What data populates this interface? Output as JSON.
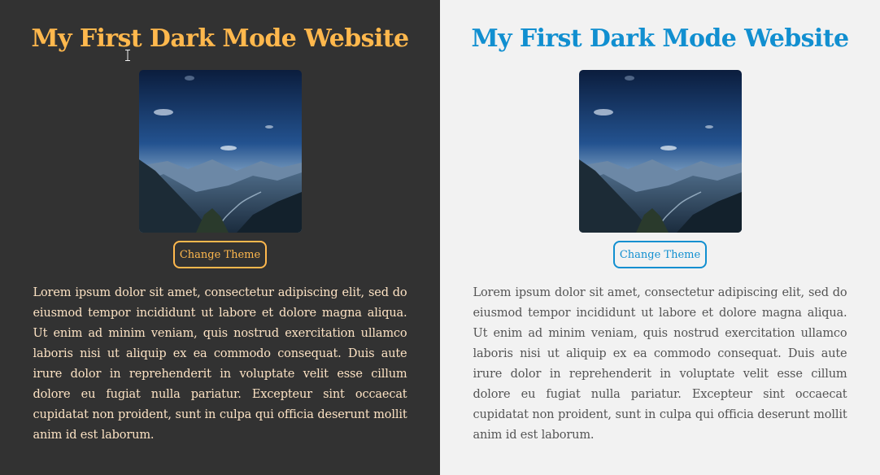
{
  "dark_panel": {
    "title": "My First Dark Mode Website",
    "button_label": "Change Theme",
    "body": "Lorem ipsum dolor sit amet, consectetur adipiscing elit, sed do eiusmod tempor incididunt ut labore et dolore magna aliqua. Ut enim ad minim veniam, quis nostrud exercitation ullamco laboris nisi ut aliquip ex ea commodo consequat. Duis aute irure dolor in reprehenderit in voluptate velit esse cillum dolore eu fugiat nulla pariatur. Excepteur sint occaecat cupidatat non proident, sunt in culpa qui officia deserunt mollit anim id est laborum.",
    "background_color": "#323232",
    "accent_color": "#ffb84d",
    "text_color": "#fde3c4"
  },
  "light_panel": {
    "title": "My First Dark Mode Website",
    "button_label": "Change Theme",
    "body": "Lorem ipsum dolor sit amet, consectetur adipiscing elit, sed do eiusmod tempor incididunt ut labore et dolore magna aliqua. Ut enim ad minim veniam, quis nostrud exercitation ullamco laboris nisi ut aliquip ex ea commodo consequat. Duis aute irure dolor in reprehenderit in voluptate velit esse cillum dolore eu fugiat nulla pariatur. Excepteur sint occaecat cupidatat non proident, sunt in culpa qui officia deserunt mollit anim id est laborum.",
    "background_color": "#f2f2f2",
    "accent_color": "#118fd0",
    "text_color": "#545454"
  },
  "icons": {
    "photo": "mountain-landscape-image",
    "cursor": "text-cursor-icon"
  }
}
